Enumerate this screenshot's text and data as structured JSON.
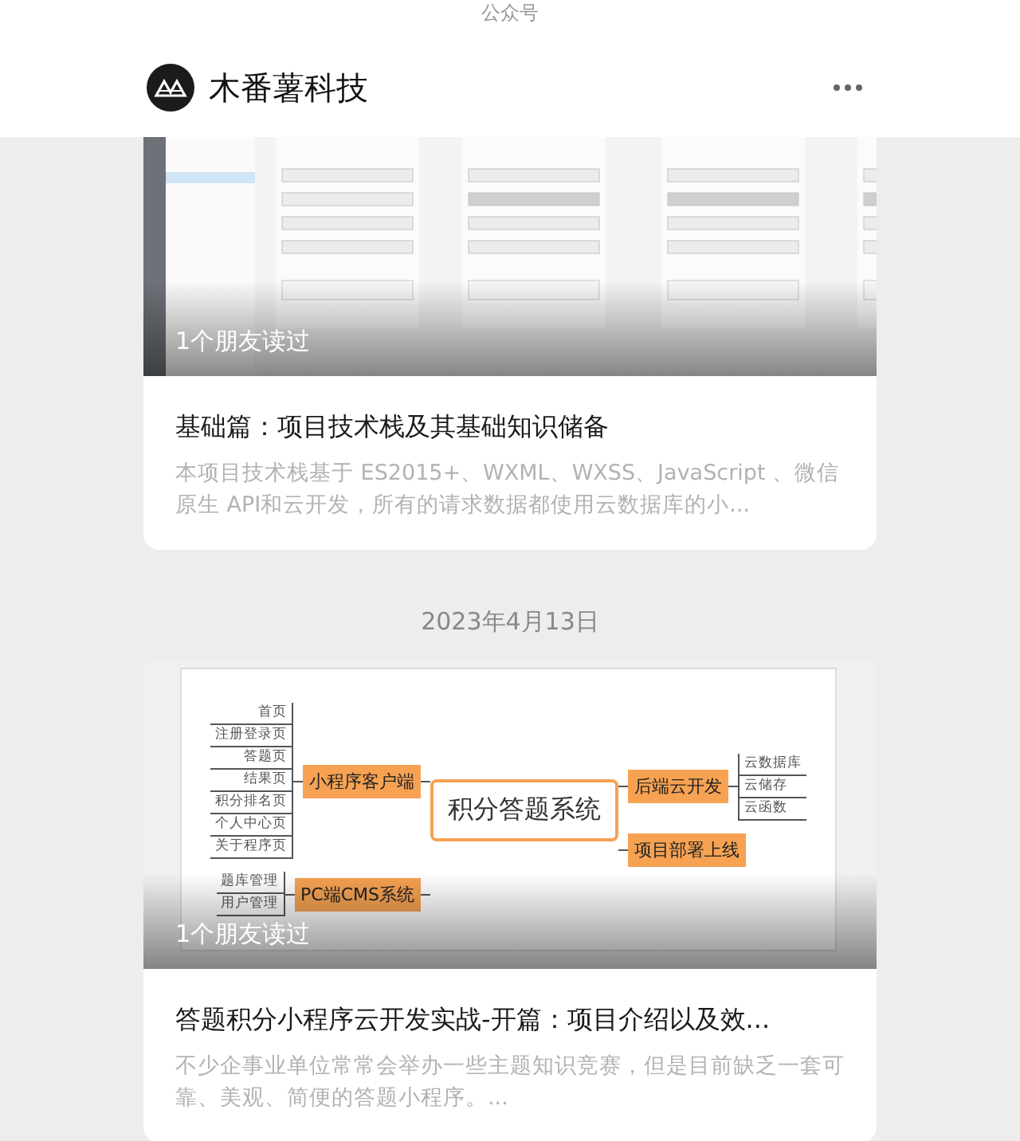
{
  "top_bar": {
    "title": "公众号"
  },
  "account": {
    "name": "木番薯科技"
  },
  "feed": [
    {
      "kind": "article",
      "readers": "1个朋友读过",
      "title": "基础篇：项目技术栈及其基础知识储备",
      "summary": "本项目技术栈基于 ES2015+、WXML、WXSS、JavaScript 、微信原生 API和云开发，所有的请求数据都使用云数据库的小..."
    },
    {
      "kind": "date",
      "text": "2023年4月13日"
    },
    {
      "kind": "article",
      "thumbnail": {
        "kind": "mindmap",
        "center": "积分答题系统",
        "left": [
          {
            "label": "小程序客户端",
            "children": [
              "首页",
              "注册登录页",
              "答题页",
              "结果页",
              "积分排名页",
              "个人中心页",
              "关于程序页"
            ]
          },
          {
            "label": "PC端CMS系统",
            "children": [
              "题库管理",
              "用户管理"
            ]
          }
        ],
        "right": [
          {
            "label": "后端云开发",
            "children": [
              "云数据库",
              "云储存",
              "云函数"
            ]
          },
          {
            "label": "项目部署上线"
          }
        ]
      },
      "readers": "1个朋友读过",
      "title": "答题积分小程序云开发实战-开篇：项目介绍以及效...",
      "summary": "不少企事业单位常常会举办一些主题知识竞赛，但是目前缺乏一套可靠、美观、简便的答题小程序。..."
    }
  ]
}
